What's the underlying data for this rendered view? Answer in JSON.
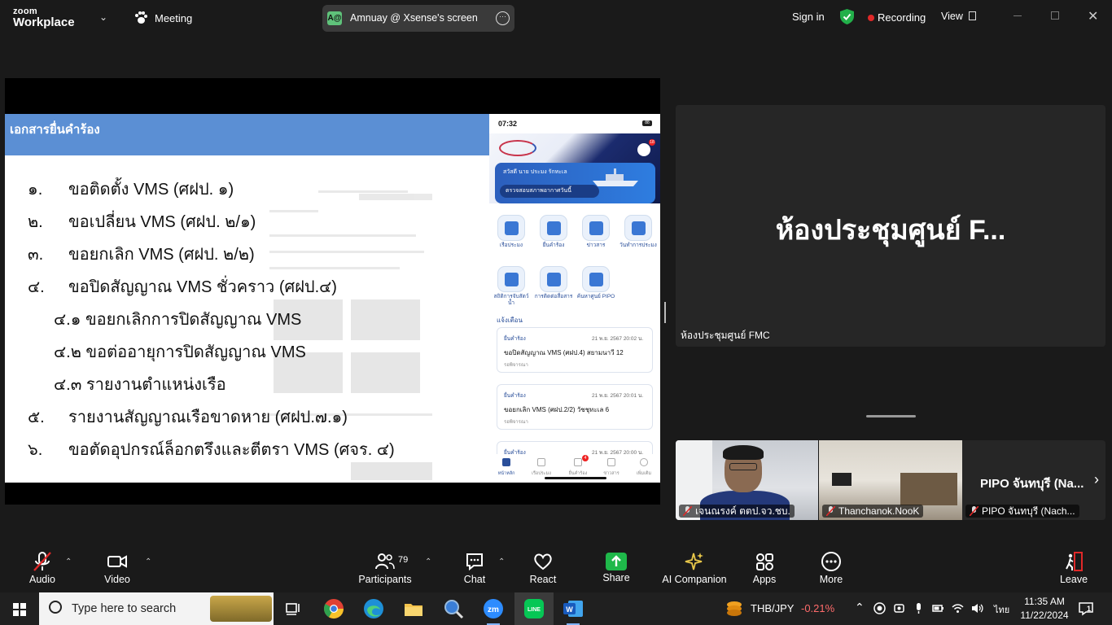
{
  "app": {
    "brand_top": "zoom",
    "brand_bottom": "Workplace",
    "meeting_label": "Meeting",
    "sharing_label": "Amnuay @ Xsense's screen",
    "sharing_icon_text": "A@",
    "sign_in": "Sign in",
    "recording": "Recording",
    "view": "View",
    "colors": {
      "record": "#e02828",
      "share_green": "#1fb84a",
      "shield_green": "#22b04a"
    }
  },
  "slide": {
    "title": "เอกสารยื่นคำร้อง",
    "items": [
      {
        "num": "๑.",
        "text": "ขอติดตั้ง VMS (ศฝป. ๑)"
      },
      {
        "num": "๒.",
        "text": "ขอเปลี่ยน VMS (ศฝป. ๒/๑)"
      },
      {
        "num": "๓.",
        "text": "ขอยกเลิก VMS (ศฝป. ๒/๒)"
      },
      {
        "num": "๔.",
        "text": "ขอปิดสัญญาณ  VMS ชั่วคราว (ศฝป.๔)"
      }
    ],
    "subitems": [
      "๔.๑ ขอยกเลิกการปิดสัญญาณ VMS",
      "๔.๒ ขอต่ออายุการปิดสัญญาณ VMS",
      "๔.๓ รายงานตำแหน่งเรือ"
    ],
    "items2": [
      {
        "num": "๕.",
        "text": "รายงานสัญญาณเรือขาดหาย (ศฝป.๗.๑)"
      },
      {
        "num": "๖.",
        "text": "ขอตัดอุปกรณ์ล็อกตรึงและตีตรา VMS (ศจร. ๔)"
      }
    ]
  },
  "phone": {
    "time": "07:32",
    "battery": "88",
    "badge": "18",
    "hello": "สวัสดี นาย ประมง รักทะเล",
    "check_button": "ตรวจสอบสภาพอากาศวันนี้",
    "menu": [
      {
        "label": "เรือประมง",
        "badge": ""
      },
      {
        "label": "ยื่นคำร้อง",
        "badge": "4"
      },
      {
        "label": "ข่าวสาร",
        "badge": ""
      },
      {
        "label": "วันทำการประมง",
        "badge": ""
      },
      {
        "label": "สถิติการจับสัตว์น้ำ",
        "badge": ""
      },
      {
        "label": "การติดต่อสื่อสาร",
        "badge": ""
      },
      {
        "label": "ค้นหาศูนย์ PIPO",
        "badge": ""
      }
    ],
    "notifications_label": "แจ้งเตือน",
    "cards": [
      {
        "tag": "ยื่นคำร้อง",
        "date": "21 พ.ย. 2567 20:02 น.",
        "title": "ขอปิดสัญญาณ VMS (ศฝป.4) สยามนาวี 12",
        "status": "รอพิจารณา"
      },
      {
        "tag": "ยื่นคำร้อง",
        "date": "21 พ.ย. 2567 20:01 น.",
        "title": "ขอยกเลิก VMS (ศฝป.2/2) วัชชุทะเล 6",
        "status": "รอพิจารณา"
      },
      {
        "tag": "ยื่นคำร้อง",
        "date": "21 พ.ย. 2567 20:00 น.",
        "title": "",
        "status": ""
      }
    ],
    "nav": [
      "หน้าหลัก",
      "เรือประมง",
      "ยื่นคำร้อง",
      "ข่าวสาร",
      "เพิ่มเติม"
    ],
    "nav_badge": "4"
  },
  "participants_panel": {
    "main_name": "ห้องประชุมศูนย์ F...",
    "main_label": "ห้องประชุมศูนย์ FMC",
    "videos": [
      {
        "name": "เจนณรงค์ ตตป.จว.ชบ."
      },
      {
        "name": "Thanchanok.NooK"
      },
      {
        "name": "PIPO จันทบุรี (Nach..."
      }
    ],
    "third_tile_title": "PIPO จันทบุรี (Na..."
  },
  "toolbar": {
    "audio": "Audio",
    "video": "Video",
    "participants": "Participants",
    "participants_count": "79",
    "chat": "Chat",
    "react": "React",
    "share": "Share",
    "ai": "AI Companion",
    "apps": "Apps",
    "more": "More",
    "leave": "Leave"
  },
  "taskbar": {
    "search_placeholder": "Type here to search",
    "ticker_symbol": "THB/JPY",
    "ticker_change": "-0.21%",
    "lang": "ไทย",
    "time": "11:35 AM",
    "date": "11/22/2024",
    "notif_count": "1"
  }
}
